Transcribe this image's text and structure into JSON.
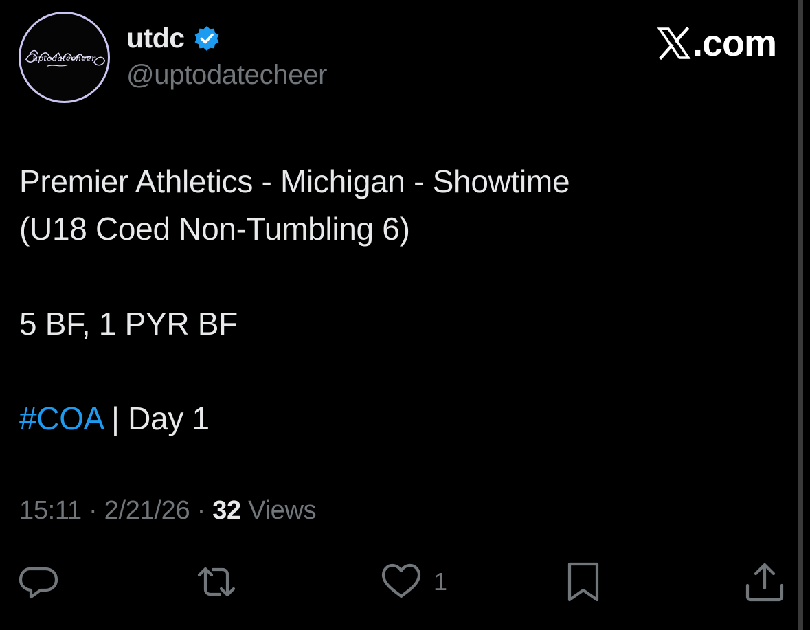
{
  "author": {
    "display_name": "utdc",
    "handle": "@uptodatecheer",
    "verified": true,
    "avatar_icon": "butterfly-script-logo-icon",
    "avatar_script": "uptodatecheer"
  },
  "brand": {
    "icon": "x-logo-icon",
    "domain_text": ".com"
  },
  "tweet": {
    "lines": [
      "Premier Athletics - Michigan - Showtime",
      "(U18 Coed Non-Tumbling 6)",
      "",
      "5 BF, 1 PYR BF",
      ""
    ],
    "hashtag": "#COA",
    "hashtag_suffix": " | Day 1"
  },
  "meta": {
    "time": "15:11",
    "separator": " · ",
    "date": "2/21/26",
    "views_count": "32",
    "views_label": " Views"
  },
  "actions": {
    "reply_icon": "reply-icon",
    "repost_icon": "repost-icon",
    "like_icon": "heart-icon",
    "like_count": "1",
    "bookmark_icon": "bookmark-icon",
    "share_icon": "share-icon"
  },
  "colors": {
    "background": "#000000",
    "text": "#e7e9ea",
    "secondary": "#71767b",
    "accent": "#1d9bf0"
  }
}
